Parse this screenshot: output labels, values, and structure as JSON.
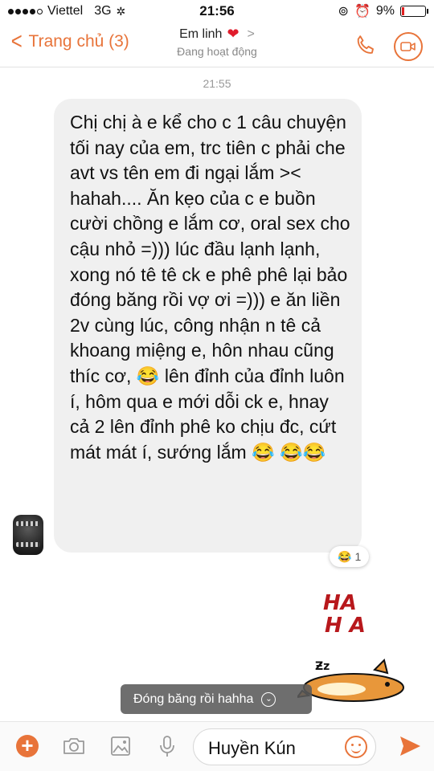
{
  "status_bar": {
    "carrier": "Viettel",
    "network": "3G",
    "time": "21:56",
    "battery": "9%",
    "battery_level": 0.09
  },
  "nav": {
    "back_label": "Trang chủ (3)",
    "contact_name": "Em linh",
    "contact_status": "Đang hoạt động"
  },
  "chat": {
    "timestamp": "21:55",
    "message": "Chị chị à e kể cho c 1 câu chuyện tối nay của em, trc tiên c phải che avt vs tên em đi ngại lắm >< hahah.... Ăn kẹo của c e buồn cười chồng e lắm cơ, oral sex cho cậu nhỏ =))) lúc đầu lạnh lạnh, xong nó tê tê ck e phê phê lại bảo đóng băng rồi vợ ơi =))) e ăn liền 2v cùng lúc, công nhận n tê cả khoang miệng e, hôn nhau cũng thíc cơ, 😂 lên đỉnh của đỉnh luôn í, hôm qua e mới dỗi ck e, hnay cả 2 lên đỉnh phê ko chịu đc, cứt mát mát í, sướng lắm 😂 😂😂",
    "reaction_emoji": "😂",
    "reaction_count": "1",
    "sticker_line1": "HA",
    "sticker_line2": "H A"
  },
  "toast": {
    "text": "Đóng băng rồi hahha"
  },
  "composer": {
    "input_text": "Huyền Kún"
  },
  "colors": {
    "accent": "#e8743a",
    "bubble_bg": "#f0f0f0",
    "heart": "#e01c2c"
  },
  "icons": [
    "back-chevron-icon",
    "heart-icon",
    "phone-icon",
    "video-icon",
    "plus-icon",
    "camera-icon",
    "image-icon",
    "microphone-icon",
    "emoji-icon",
    "send-icon"
  ]
}
